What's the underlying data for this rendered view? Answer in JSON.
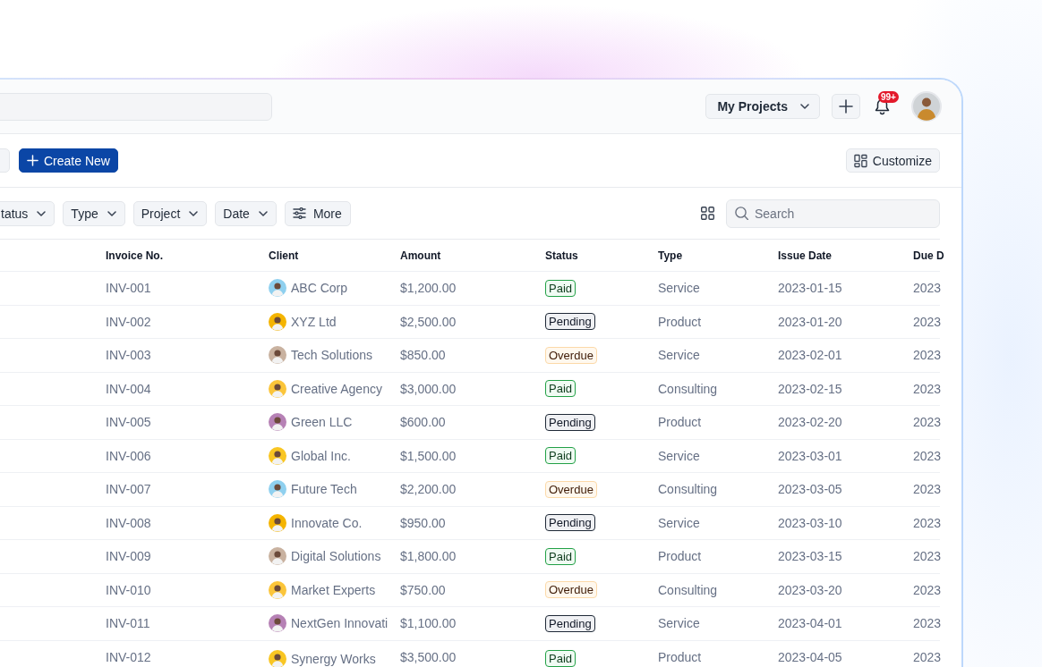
{
  "header": {
    "project_menu": {
      "label": "My Projects"
    },
    "notifications": {
      "badge": "99+"
    }
  },
  "toolbar": {
    "create_button": {
      "label": "Create New"
    },
    "customize_button": {
      "label": "Customize"
    }
  },
  "filters": [
    {
      "label": "tatus",
      "kind": "dropdown"
    },
    {
      "label": "Type",
      "kind": "dropdown"
    },
    {
      "label": "Project",
      "kind": "dropdown"
    },
    {
      "label": "Date",
      "kind": "dropdown"
    },
    {
      "label": "More",
      "kind": "more"
    }
  ],
  "search": {
    "placeholder": "Search"
  },
  "table": {
    "columns": [
      "Invoice No.",
      "Client",
      "Amount",
      "Status",
      "Type",
      "Issue Date",
      "Due D"
    ],
    "rows": [
      {
        "invoice_no": "INV-001",
        "client": "ABC Corp",
        "color": "#8fd0ef",
        "amount": "$1,200.00",
        "status": {
          "label": "Paid",
          "kind": "paid"
        },
        "type": "Service",
        "issue_date": "2023-01-15",
        "due_date": "2023"
      },
      {
        "invoice_no": "INV-002",
        "client": "XYZ Ltd",
        "color": "#f4b400",
        "amount": "$2,500.00",
        "status": {
          "label": "Pending",
          "kind": "pending"
        },
        "type": "Product",
        "issue_date": "2023-01-20",
        "due_date": "2023"
      },
      {
        "invoice_no": "INV-003",
        "client": "Tech Solutions",
        "color": "#c9b2a0",
        "amount": "$850.00",
        "status": {
          "label": "Overdue",
          "kind": "overdue"
        },
        "type": "Service",
        "issue_date": "2023-02-01",
        "due_date": "2023"
      },
      {
        "invoice_no": "INV-004",
        "client": "Creative Agency",
        "color": "#fbc53a",
        "amount": "$3,000.00",
        "status": {
          "label": "Paid",
          "kind": "paid"
        },
        "type": "Consulting",
        "issue_date": "2023-02-15",
        "due_date": "2023"
      },
      {
        "invoice_no": "INV-005",
        "client": "Green LLC",
        "color": "#b681b5",
        "amount": "$600.00",
        "status": {
          "label": "Pending",
          "kind": "pending"
        },
        "type": "Product",
        "issue_date": "2023-02-20",
        "due_date": "2023"
      },
      {
        "invoice_no": "INV-006",
        "client": "Global Inc.",
        "color": "#f9c623",
        "amount": "$1,500.00",
        "status": {
          "label": "Paid",
          "kind": "paid"
        },
        "type": "Service",
        "issue_date": "2023-03-01",
        "due_date": "2023"
      },
      {
        "invoice_no": "INV-007",
        "client": "Future Tech",
        "color": "#8fd0ef",
        "amount": "$2,200.00",
        "status": {
          "label": "Overdue",
          "kind": "overdue"
        },
        "type": "Consulting",
        "issue_date": "2023-03-05",
        "due_date": "2023"
      },
      {
        "invoice_no": "INV-008",
        "client": "Innovate Co.",
        "color": "#f4b400",
        "amount": "$950.00",
        "status": {
          "label": "Pending",
          "kind": "pending"
        },
        "type": "Service",
        "issue_date": "2023-03-10",
        "due_date": "2023"
      },
      {
        "invoice_no": "INV-009",
        "client": "Digital Solutions",
        "color": "#c9b2a0",
        "amount": "$1,800.00",
        "status": {
          "label": "Paid",
          "kind": "paid"
        },
        "type": "Product",
        "issue_date": "2023-03-15",
        "due_date": "2023"
      },
      {
        "invoice_no": "INV-010",
        "client": "Market Experts",
        "color": "#fbc53a",
        "amount": "$750.00",
        "status": {
          "label": "Overdue",
          "kind": "overdue"
        },
        "type": "Consulting",
        "issue_date": "2023-03-20",
        "due_date": "2023"
      },
      {
        "invoice_no": "INV-011",
        "client": "NextGen Innovati",
        "color": "#b681b5",
        "amount": "$1,100.00",
        "status": {
          "label": "Pending",
          "kind": "pending"
        },
        "type": "Service",
        "issue_date": "2023-04-01",
        "due_date": "2023"
      },
      {
        "invoice_no": "INV-012",
        "client": "Synergy Works",
        "color": "#f9c623",
        "amount": "$3,500.00",
        "status": {
          "label": "Paid",
          "kind": "paid"
        },
        "type": "Product",
        "issue_date": "2023-04-05",
        "due_date": "2023"
      }
    ]
  }
}
